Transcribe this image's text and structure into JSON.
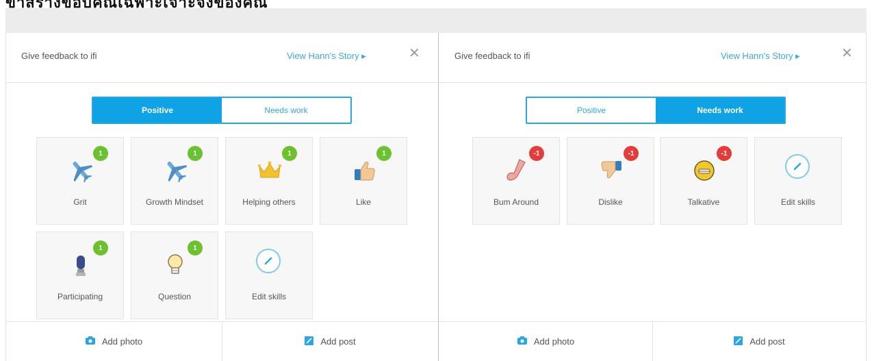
{
  "top_caption": "ข้าสร้างขอบคุณเฉพาะเจาะจงของคุณ",
  "left_panel": {
    "header_title": "Give feedback to ifi",
    "story_link": "View Hann's Story ▸",
    "close_label": "✕",
    "toggle": {
      "positive": "Positive",
      "needs_work": "Needs work",
      "active": "positive"
    },
    "skills": [
      {
        "label": "Grit",
        "badge": "1",
        "icon": "airplane-icon"
      },
      {
        "label": "Growth Mindset",
        "badge": "1",
        "icon": "airplane-icon"
      },
      {
        "label": "Helping others",
        "badge": "1",
        "icon": "crown-icon"
      },
      {
        "label": "Like",
        "badge": "1",
        "icon": "thumbs-up-icon"
      },
      {
        "label": "Participating",
        "badge": "1",
        "icon": "microphone-icon"
      },
      {
        "label": "Question",
        "badge": "1",
        "icon": "lightbulb-icon"
      },
      {
        "label": "Edit skills",
        "badge": "",
        "icon": "pencil-icon"
      }
    ],
    "footer": {
      "add_photo": "Add photo",
      "add_post": "Add post"
    }
  },
  "right_panel": {
    "header_title": "Give feedback to ifi",
    "story_link": "View Hann's Story ▸",
    "close_label": "✕",
    "toggle": {
      "positive": "Positive",
      "needs_work": "Needs work",
      "active": "needs_work"
    },
    "skills": [
      {
        "label": "Bum Around",
        "badge": "-1",
        "icon": "sock-icon"
      },
      {
        "label": "Dislike",
        "badge": "-1",
        "icon": "thumbs-down-icon"
      },
      {
        "label": "Talkative",
        "badge": "-1",
        "icon": "talkative-face-icon"
      },
      {
        "label": "Edit skills",
        "badge": "",
        "icon": "pencil-icon"
      }
    ],
    "footer": {
      "add_photo": "Add photo",
      "add_post": "Add post"
    }
  },
  "colors": {
    "accent": "#0fa3e6",
    "positive_badge": "#6cc12f",
    "negative_badge": "#e43b3b",
    "link": "#3ea6e0"
  }
}
